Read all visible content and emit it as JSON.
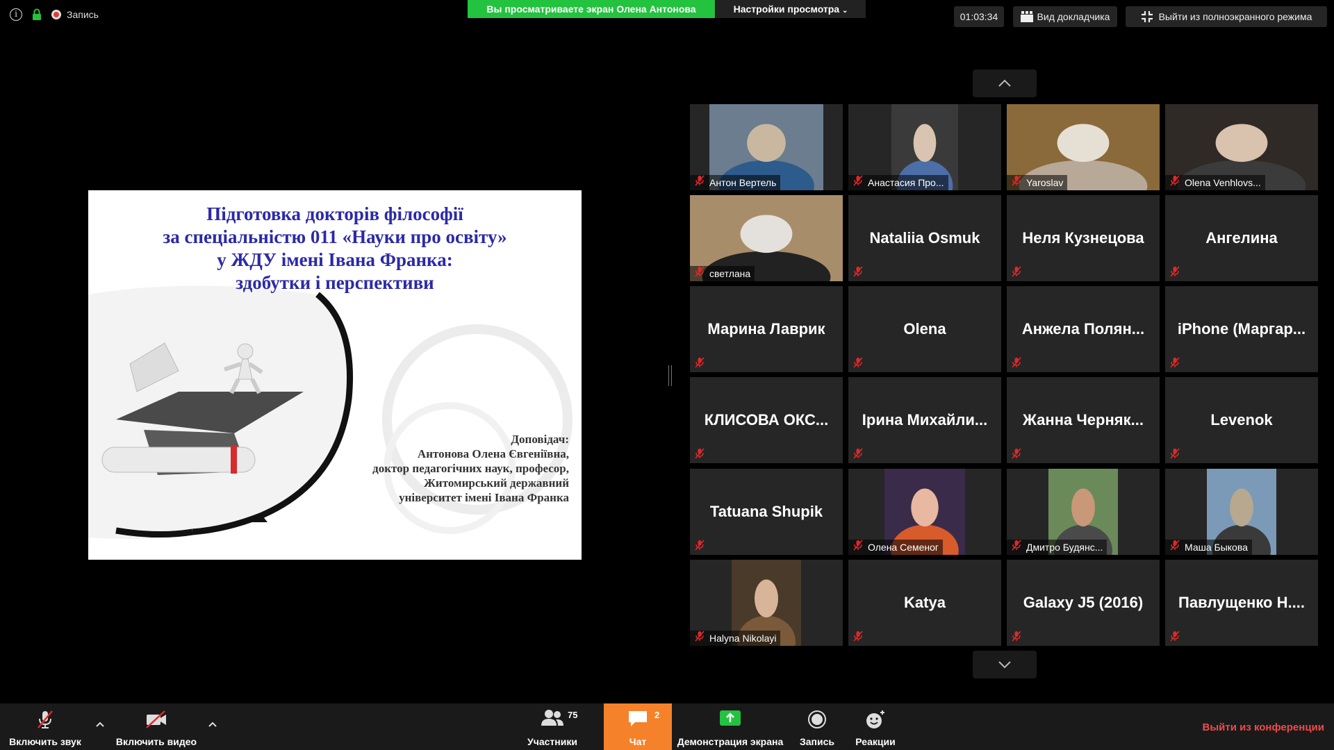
{
  "topbar": {
    "recording_label": "Запись",
    "share_banner": "Вы просматриваете экран Олена Антонова",
    "view_settings": "Настройки просмотра",
    "timer": "01:03:34",
    "speaker_view": "Вид докладчика",
    "exit_fullscreen": "Выйти из полноэкранного режима"
  },
  "slide": {
    "title_lines": [
      "Підготовка докторів філософії",
      "за спеціальністю 011 «Науки про освіту»",
      "у ЖДУ імені Івана Франка:",
      "здобутки і перспективи"
    ],
    "speaker_lines": [
      "Доповідач:",
      "Антонова Олена Євгеніївна,",
      "доктор педагогічних наук, професор,",
      "Житомирський державний",
      "університет імені Івана Франка"
    ]
  },
  "gallery": {
    "tiles": [
      {
        "name": "Антон Вертель",
        "video": true
      },
      {
        "name": "Анастасия Про...",
        "video": true
      },
      {
        "name": "Yaroslav",
        "video": true
      },
      {
        "name": "Olena Venhlovs...",
        "video": true
      },
      {
        "name": "светлана",
        "video": true
      },
      {
        "name": "Nataliia Osmuk",
        "video": false
      },
      {
        "name": "Неля Кузнецова",
        "video": false
      },
      {
        "name": "Ангелина",
        "video": false
      },
      {
        "name": "Марина Лаврик",
        "video": false
      },
      {
        "name": "Olena",
        "video": false
      },
      {
        "name": "Анжела Полян...",
        "video": false
      },
      {
        "name": "iPhone (Маргар...",
        "video": false
      },
      {
        "name": "КЛИСОВА ОКС...",
        "video": false
      },
      {
        "name": "Ірина Михайли...",
        "video": false
      },
      {
        "name": "Жанна Черняк...",
        "video": false
      },
      {
        "name": "Levenok",
        "video": false
      },
      {
        "name": "Tatuana Shupik",
        "video": false
      },
      {
        "name": "Олена Семеног",
        "video": true
      },
      {
        "name": "Дмитро Будянс...",
        "video": true
      },
      {
        "name": "Маша Быкова",
        "video": true
      },
      {
        "name": "Halyna Nikolayi",
        "video": true
      },
      {
        "name": "Katya",
        "video": false
      },
      {
        "name": "Galaxy J5 (2016)",
        "video": false
      },
      {
        "name": "Павлущенко Н....",
        "video": false
      }
    ]
  },
  "toolbar": {
    "unmute": "Включить звук",
    "start_video": "Включить видео",
    "participants": "Участники",
    "participants_count": "75",
    "chat": "Чат",
    "chat_count": "2",
    "share_screen": "Демонстрация экрана",
    "record": "Запись",
    "reactions": "Реакции",
    "leave": "Выйти из конференции"
  },
  "colors": {
    "share_banner": "#23c23f",
    "chat_active": "#f5822a",
    "leave": "#f04a4a",
    "slide_title": "#2b2aa8",
    "muted_red": "#e02828"
  }
}
